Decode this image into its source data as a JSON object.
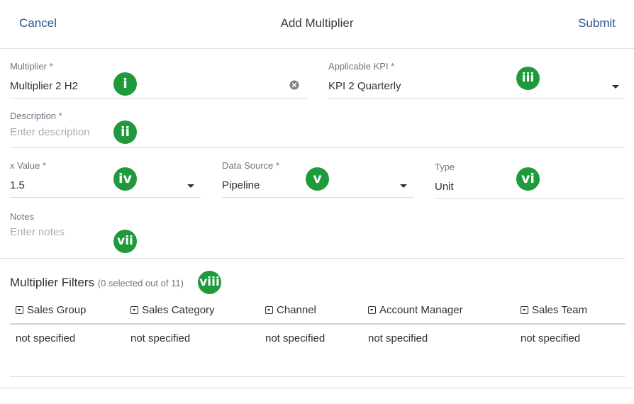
{
  "header": {
    "cancel_label": "Cancel",
    "title": "Add Multiplier",
    "submit_label": "Submit"
  },
  "form": {
    "multiplier": {
      "label": "Multiplier *",
      "value": "Multiplier 2 H2"
    },
    "applicable_kpi": {
      "label": "Applicable KPI *",
      "value": "KPI 2 Quarterly"
    },
    "description": {
      "label": "Description *",
      "placeholder": "Enter description"
    },
    "x_value": {
      "label": "x Value *",
      "value": "1.5"
    },
    "data_source": {
      "label": "Data Source *",
      "value": "Pipeline"
    },
    "type": {
      "label": "Type",
      "value": "Unit"
    },
    "notes": {
      "label": "Notes",
      "placeholder": "Enter notes"
    }
  },
  "annotations": [
    "i",
    "ii",
    "iii",
    "iv",
    "v",
    "vi",
    "vii",
    "viii"
  ],
  "filters": {
    "title": "Multiplier Filters",
    "subtitle": "(0 selected out of 11)",
    "columns": [
      {
        "label": "Sales Group",
        "value": "not specified"
      },
      {
        "label": "Sales Category",
        "value": "not specified"
      },
      {
        "label": "Channel",
        "value": "not specified"
      },
      {
        "label": "Account Manager",
        "value": "not specified"
      },
      {
        "label": "Sales Team",
        "value": "not specified"
      }
    ]
  },
  "colors": {
    "accent": "#27558f",
    "badge": "#1e9a3c",
    "divider": "#dcdcdc"
  },
  "icons": {
    "clear": "clear-circle-icon",
    "dropdown": "caret-down-icon",
    "filter": "filter-dropdown-icon"
  }
}
